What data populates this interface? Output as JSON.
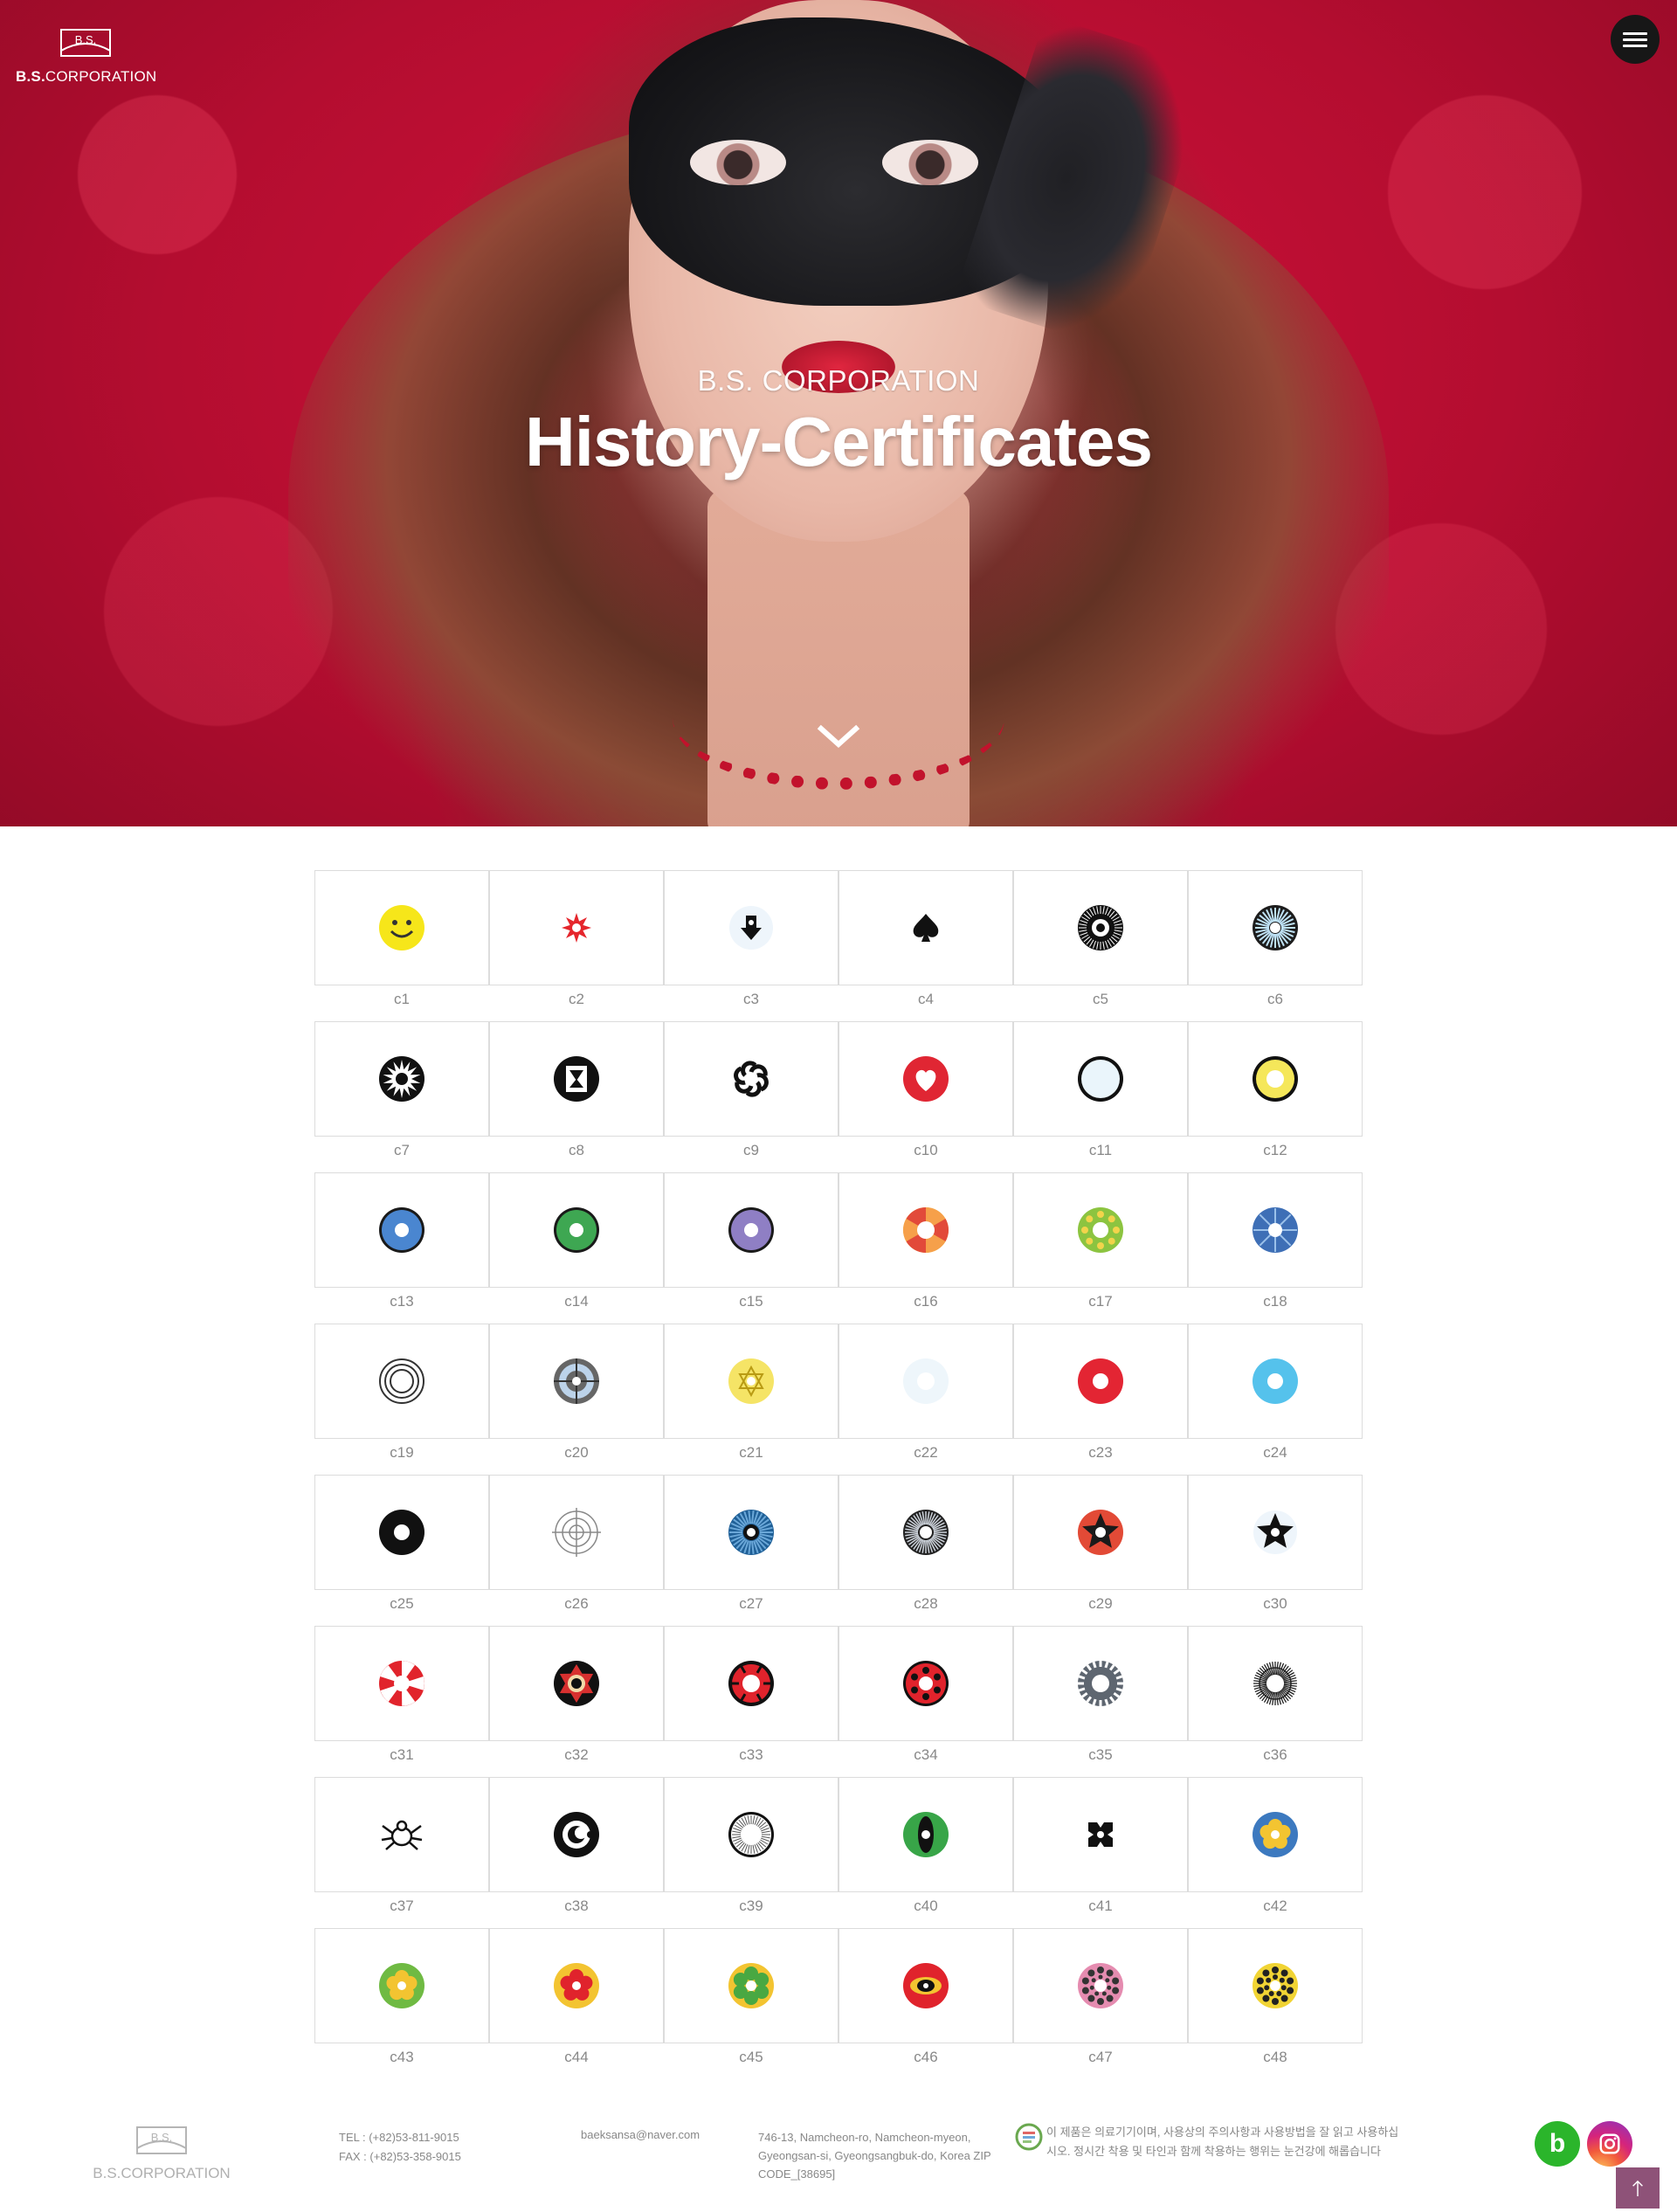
{
  "header": {
    "logo_mark_text": "B.S.",
    "logo_name_bold": "B.S.",
    "logo_name_rest": "CORPORATION",
    "menu_icon": "hamburger-menu-icon"
  },
  "hero": {
    "subtitle": "B.S. CORPORATION",
    "title": "History-Certificates",
    "scroll_icon": "chevron-down-icon"
  },
  "grid": {
    "items": [
      {
        "label": "c1"
      },
      {
        "label": "c2"
      },
      {
        "label": "c3"
      },
      {
        "label": "c4"
      },
      {
        "label": "c5"
      },
      {
        "label": "c6"
      },
      {
        "label": "c7"
      },
      {
        "label": "c8"
      },
      {
        "label": "c9"
      },
      {
        "label": "c10"
      },
      {
        "label": "c11"
      },
      {
        "label": "c12"
      },
      {
        "label": "c13"
      },
      {
        "label": "c14"
      },
      {
        "label": "c15"
      },
      {
        "label": "c16"
      },
      {
        "label": "c17"
      },
      {
        "label": "c18"
      },
      {
        "label": "c19"
      },
      {
        "label": "c20"
      },
      {
        "label": "c21"
      },
      {
        "label": "c22"
      },
      {
        "label": "c23"
      },
      {
        "label": "c24"
      },
      {
        "label": "c25"
      },
      {
        "label": "c26"
      },
      {
        "label": "c27"
      },
      {
        "label": "c28"
      },
      {
        "label": "c29"
      },
      {
        "label": "c30"
      },
      {
        "label": "c31"
      },
      {
        "label": "c32"
      },
      {
        "label": "c33"
      },
      {
        "label": "c34"
      },
      {
        "label": "c35"
      },
      {
        "label": "c36"
      },
      {
        "label": "c37"
      },
      {
        "label": "c38"
      },
      {
        "label": "c39"
      },
      {
        "label": "c40"
      },
      {
        "label": "c41"
      },
      {
        "label": "c42"
      },
      {
        "label": "c43"
      },
      {
        "label": "c44"
      },
      {
        "label": "c45"
      },
      {
        "label": "c46"
      },
      {
        "label": "c47"
      },
      {
        "label": "c48"
      }
    ]
  },
  "footer": {
    "logo_mark_text": "B.S.",
    "logo_name": "B.S.CORPORATION",
    "tel": "TEL : (+82)53-811-9015",
    "fax": "FAX : (+82)53-358-9015",
    "email": "baeksansa@naver.com",
    "address_1": "746-13, Namcheon-ro, Namcheon-myeon,",
    "address_2": "Gyeongsan-si, Gyeongsangbuk-do, Korea ZIP",
    "address_3": "CODE_[38695]",
    "notice": "이 제품은 의료기기이며, 사용상의 주의사항과 사용방법을 잘 읽고 사용하십시오. 정시간 착용 및 타인과 함께 착용하는 행위는 눈건강에 해롭습니다",
    "notice_icon": "medical-device-badge-icon"
  },
  "sns": {
    "blog_label": "b",
    "blog_icon": "blog-icon",
    "instagram_icon": "instagram-icon",
    "to_top_icon": "arrow-up-icon"
  },
  "colors": {
    "hero_red": "#c8102e",
    "menu_button": "#171717",
    "to_top": "#8e5278",
    "blog_green": "#2bb52b"
  }
}
